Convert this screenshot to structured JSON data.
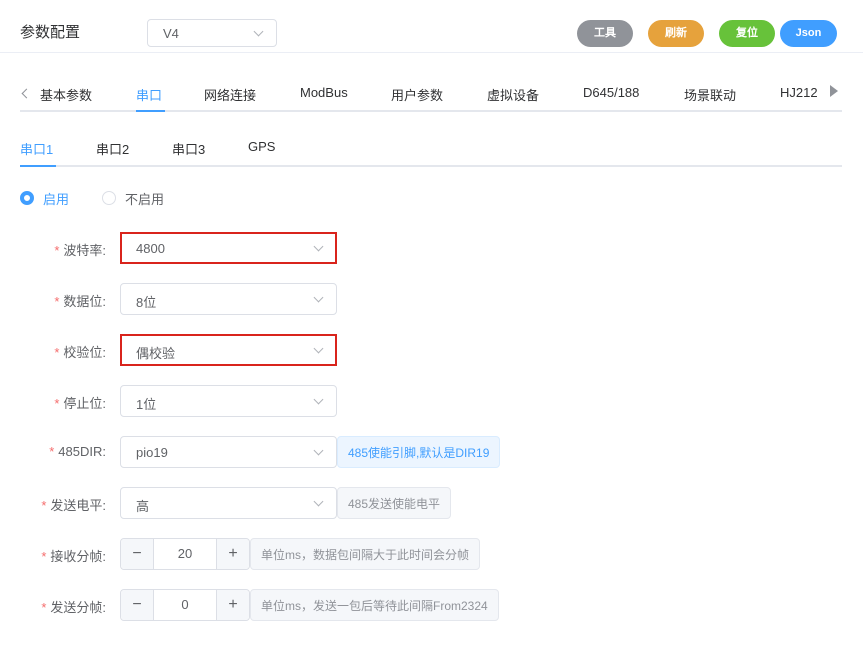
{
  "header": {
    "title": "参数配置",
    "version": "V4",
    "buttons": {
      "tool": "工具",
      "refresh": "刷新",
      "reset": "复位",
      "json": "Json"
    }
  },
  "tabs": [
    "基本参数",
    "串口",
    "网络连接",
    "ModBus",
    "用户参数",
    "虚拟设备",
    "D645/188",
    "场景联动",
    "HJ212"
  ],
  "active_tab": "串口",
  "subtabs": [
    "串口1",
    "串口2",
    "串口3",
    "GPS"
  ],
  "active_subtab": "串口1",
  "enable": {
    "on_label": "启用",
    "off_label": "不启用",
    "selected": "启用"
  },
  "form": {
    "baud": {
      "label": "波特率:",
      "value": "4800"
    },
    "databits": {
      "label": "数据位:",
      "value": "8位"
    },
    "parity": {
      "label": "校验位:",
      "value": "偶校验"
    },
    "stopbits": {
      "label": "停止位:",
      "value": "1位"
    },
    "dir485": {
      "label": "485DIR:",
      "value": "pio19",
      "hint": "485使能引脚,默认是DIR19"
    },
    "level": {
      "label": "发送电平:",
      "value": "高",
      "hint": "485发送使能电平"
    },
    "recv_frame": {
      "label": "接收分帧:",
      "value": "20",
      "hint": "单位ms，数据包间隔大于此时间会分帧"
    },
    "send_frame": {
      "label": "发送分帧:",
      "value": "0",
      "hint": "单位ms，发送一包后等待此间隔From2324"
    }
  },
  "stepper": {
    "minus": "−",
    "plus": "+"
  },
  "colors": {
    "primary": "#409eff",
    "highlight": "#d9241c",
    "required": "#f56c6c"
  }
}
